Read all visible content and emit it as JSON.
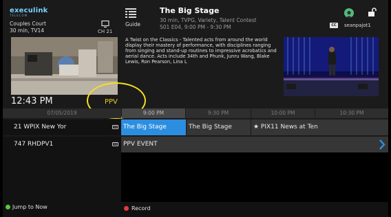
{
  "brand": {
    "name": "execulink",
    "tagline": "TELECOM"
  },
  "current_channel": {
    "program": "Couples Court",
    "meta": "30 min, TV14",
    "channel": "CH 21",
    "clock": "12:43 PM",
    "badge": "PPV",
    "icon": "tv-icon"
  },
  "guide": {
    "label": "Guide",
    "icon": "guide-icon"
  },
  "program": {
    "title": "The Big Stage",
    "meta1": "30 min, TVPG, Variety, Talent Contest",
    "meta2": "S01 E04, 9:00 PM - 9:30 PM",
    "description": "A Twist on the Classics - Talented acts from around the world display their mastery of performance, with disciplines ranging from singing and stand-up routines to impressive acrobatics and aerial dance. Acts include 34th and Phunk, Junru Wang, Blake Lewis, Ron Pearson, Lina L"
  },
  "user": {
    "username": "seanpajot1",
    "cc": "CC",
    "avatar_icon": "avatar-icon",
    "lock_icon": "unlock-icon"
  },
  "timeline": {
    "date": "07/05/2019",
    "slots": [
      "9:00 PM",
      "9:30 PM",
      "10:00 PM",
      "10:30 PM"
    ]
  },
  "channels": [
    {
      "name": "21  WPIX New Yor",
      "hd": "HD",
      "programs": [
        "The Big Stage",
        "The Big Stage",
        "★ PIX11 News at Ten"
      ]
    },
    {
      "name": "747  RHDPV1",
      "hd": "HD",
      "programs": [
        "PPV EVENT"
      ]
    }
  ],
  "footer": {
    "jump": "Jump to Now",
    "record": "Record"
  },
  "colors": {
    "accent": "#2c8ee0",
    "ppv": "#f2cf1e",
    "ring": "#f5e11d",
    "jump_dot": "#58c740",
    "record_dot": "#e53a3a",
    "brand": "#7ad3ff"
  }
}
